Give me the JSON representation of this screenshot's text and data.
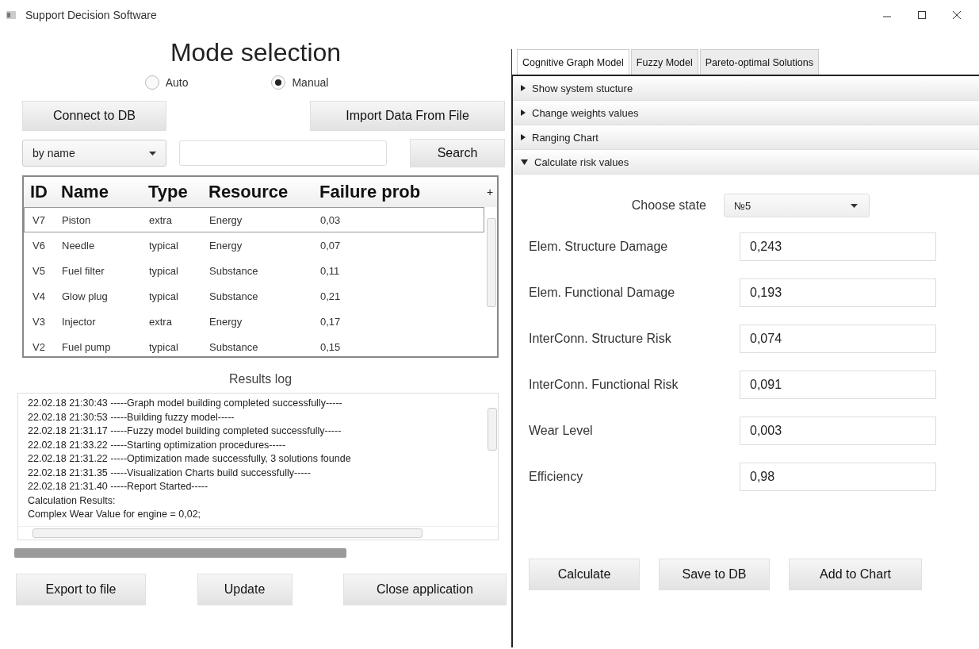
{
  "window": {
    "title": "Support Decision Software"
  },
  "mode": {
    "title": "Mode selection",
    "options": [
      {
        "label": "Auto",
        "selected": false
      },
      {
        "label": "Manual",
        "selected": true
      }
    ]
  },
  "top_buttons": [
    "Connect to DB",
    "Import Data From File"
  ],
  "search": {
    "filter": "by name",
    "button": "Search"
  },
  "table": {
    "columns": [
      "ID",
      "Name",
      "Type",
      "Resource",
      "Failure prob"
    ],
    "corner": "+",
    "rows": [
      {
        "cells": [
          "V7",
          "Piston",
          "extra",
          "Energy",
          "0,03"
        ],
        "selected": true
      },
      {
        "cells": [
          "V6",
          "Needle",
          "typical",
          "Energy",
          "0,07"
        ],
        "selected": false
      },
      {
        "cells": [
          "V5",
          "Fuel filter",
          "typical",
          "Substance",
          "0,11"
        ],
        "selected": false
      },
      {
        "cells": [
          "V4",
          "Glow plug",
          "typical",
          "Substance",
          "0,21"
        ],
        "selected": false
      },
      {
        "cells": [
          "V3",
          "Injector",
          "extra",
          "Energy",
          "0,17"
        ],
        "selected": false
      },
      {
        "cells": [
          "V2",
          "Fuel pump",
          "typical",
          "Substance",
          "0,15"
        ],
        "selected": false
      }
    ]
  },
  "log": {
    "title": "Results log",
    "lines": [
      "22.02.18  21:30:43 -----Graph model building completed successfully-----",
      "22.02.18  21:30:53 -----Building fuzzy model-----",
      "22.02.18  21:31.17 -----Fuzzy model building completed successfully-----",
      "22.02.18  21:33.22 -----Starting optimization procedures-----",
      "22.02.18  21:31.22 -----Optimization made successfully, 3 solutions founde",
      "22.02.18  21:31.35 -----Visualization Charts build successfully-----",
      "22.02.18  21:31.40 -----Report Started-----",
      "Calculation Results:",
      "Complex Wear Value for engine = 0,02;"
    ]
  },
  "progress": {
    "level": 0.69
  },
  "bottom_buttons": [
    "Export to file",
    "Update",
    "Close application"
  ],
  "tabs": [
    {
      "label": "Cognitive Graph Model",
      "selected": true
    },
    {
      "label": "Fuzzy Model",
      "selected": false
    },
    {
      "label": "Pareto-optimal Solutions",
      "selected": false
    }
  ],
  "sections": [
    {
      "label": "Show system stucture",
      "expanded": false
    },
    {
      "label": "Change weights values",
      "expanded": false
    },
    {
      "label": "Ranging Chart",
      "expanded": false
    },
    {
      "label": "Calculate risk values",
      "expanded": true
    }
  ],
  "state": {
    "label": "Choose state",
    "value": "№5"
  },
  "fields": [
    {
      "label": "Elem. Structure Damage",
      "value": "0,243"
    },
    {
      "label": "Elem. Functional Damage",
      "value": "0,193"
    },
    {
      "label": "InterConn. Structure Risk",
      "value": "0,074"
    },
    {
      "label": "InterConn. Functional Risk",
      "value": "0,091"
    },
    {
      "label": "Wear Level",
      "value": "0,003"
    },
    {
      "label": "Efficiency",
      "value": "0,98"
    }
  ],
  "actions": [
    "Calculate",
    "Save to DB",
    "Add to Chart"
  ]
}
